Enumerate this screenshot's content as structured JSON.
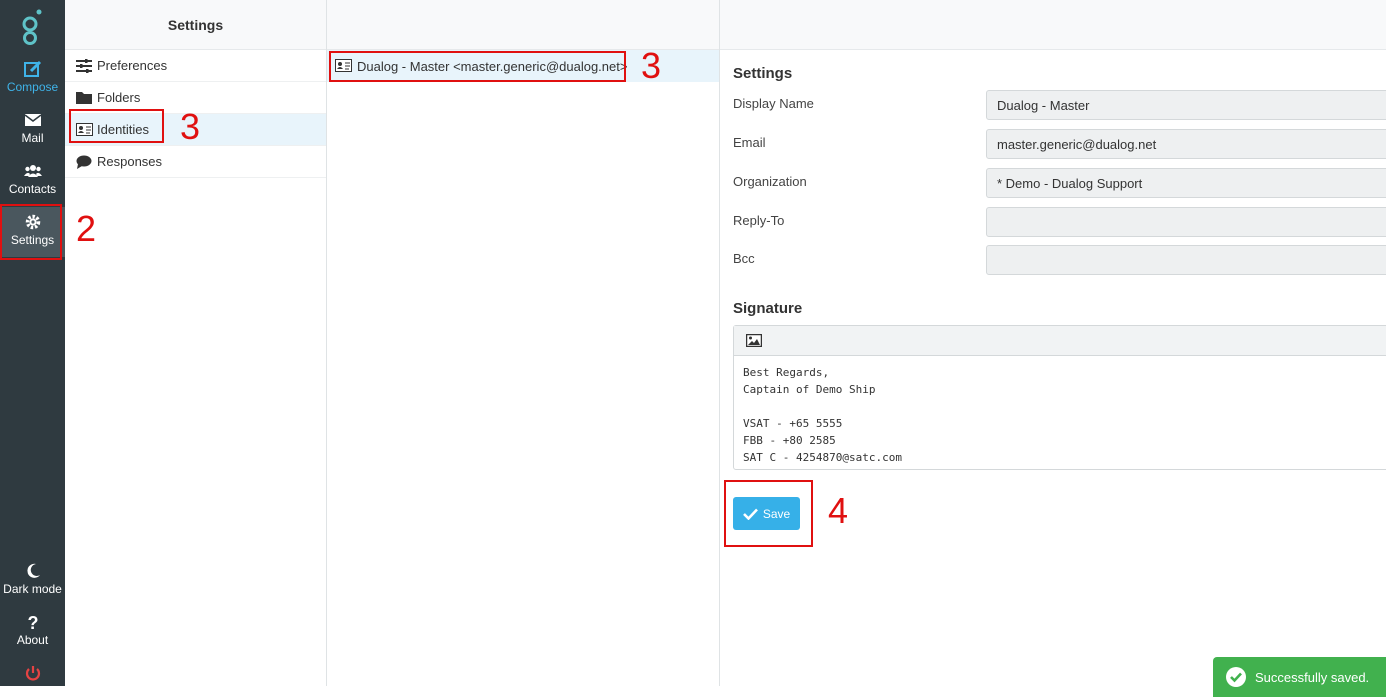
{
  "nav": {
    "items": [
      {
        "label": "Compose",
        "icon": "compose-icon"
      },
      {
        "label": "Mail",
        "icon": "mail-icon"
      },
      {
        "label": "Contacts",
        "icon": "contacts-icon"
      },
      {
        "label": "Settings",
        "icon": "gear-icon"
      },
      {
        "label": "Dark mode",
        "icon": "moon-icon"
      },
      {
        "label": "About",
        "icon": "question-icon"
      },
      {
        "label": "",
        "icon": "power-icon"
      }
    ]
  },
  "settings_panel": {
    "title": "Settings",
    "items": [
      {
        "label": "Preferences",
        "icon": "sliders-icon"
      },
      {
        "label": "Folders",
        "icon": "folder-icon"
      },
      {
        "label": "Identities",
        "icon": "id-card-icon"
      },
      {
        "label": "Responses",
        "icon": "chat-icon"
      }
    ]
  },
  "identities_list": {
    "items": [
      {
        "label": "Dualog - Master <master.generic@dualog.net>",
        "icon": "id-card-icon"
      }
    ]
  },
  "editor": {
    "settings_title": "Settings",
    "fields": [
      {
        "label": "Display Name",
        "value": "Dualog - Master"
      },
      {
        "label": "Email",
        "value": "master.generic@dualog.net"
      },
      {
        "label": "Organization",
        "value": "* Demo - Dualog Support"
      },
      {
        "label": "Reply-To",
        "value": ""
      },
      {
        "label": "Bcc",
        "value": ""
      }
    ],
    "signature_title": "Signature",
    "signature_text": "Best Regards,\nCaptain of Demo Ship\n\nVSAT - +65 5555\nFBB - +80 2585\nSAT C - 4254870@satc.com",
    "save_label": "Save"
  },
  "toast": {
    "message": "Successfully saved."
  },
  "annotations": [
    "2",
    "3",
    "3",
    "4"
  ],
  "colors": {
    "nav_bg": "#2f3a40",
    "accent": "#36b0e8",
    "annotation": "#e01010",
    "success": "#41b14e"
  }
}
